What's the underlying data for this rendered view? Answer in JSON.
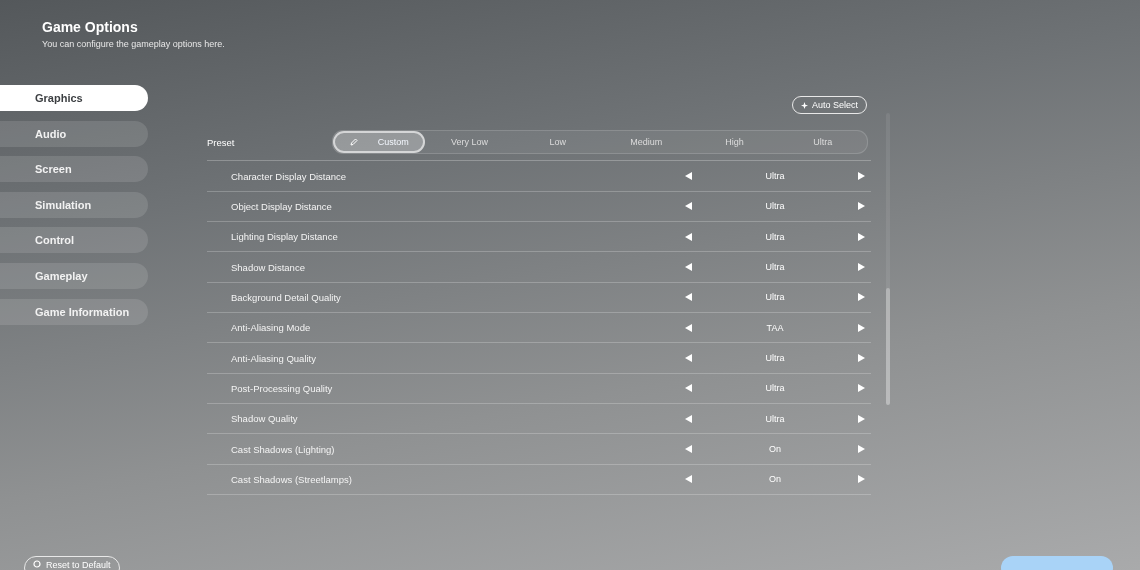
{
  "header": {
    "title": "Game Options",
    "subtitle": "You can configure the gameplay options here."
  },
  "sidebar": {
    "items": [
      {
        "label": "Graphics",
        "selected": true
      },
      {
        "label": "Audio",
        "selected": false
      },
      {
        "label": "Screen",
        "selected": false
      },
      {
        "label": "Simulation",
        "selected": false
      },
      {
        "label": "Control",
        "selected": false
      },
      {
        "label": "Gameplay",
        "selected": false
      },
      {
        "label": "Game Information",
        "selected": false
      }
    ]
  },
  "auto_select": {
    "label": "Auto Select"
  },
  "preset": {
    "label": "Preset",
    "options": [
      {
        "label": "Custom",
        "selected": true
      },
      {
        "label": "Very Low",
        "selected": false
      },
      {
        "label": "Low",
        "selected": false
      },
      {
        "label": "Medium",
        "selected": false
      },
      {
        "label": "High",
        "selected": false
      },
      {
        "label": "Ultra",
        "selected": false
      }
    ]
  },
  "settings": [
    {
      "label": "Character Display Distance",
      "value": "Ultra"
    },
    {
      "label": "Object Display Distance",
      "value": "Ultra"
    },
    {
      "label": "Lighting Display Distance",
      "value": "Ultra"
    },
    {
      "label": "Shadow Distance",
      "value": "Ultra"
    },
    {
      "label": "Background Detail Quality",
      "value": "Ultra"
    },
    {
      "label": "Anti-Aliasing Mode",
      "value": "TAA"
    },
    {
      "label": "Anti-Aliasing Quality",
      "value": "Ultra"
    },
    {
      "label": "Post-Processing Quality",
      "value": "Ultra"
    },
    {
      "label": "Shadow Quality",
      "value": "Ultra"
    },
    {
      "label": "Cast Shadows (Lighting)",
      "value": "On"
    },
    {
      "label": "Cast Shadows (Streetlamps)",
      "value": "On"
    }
  ],
  "footer": {
    "reset_label": "Reset to Default"
  }
}
